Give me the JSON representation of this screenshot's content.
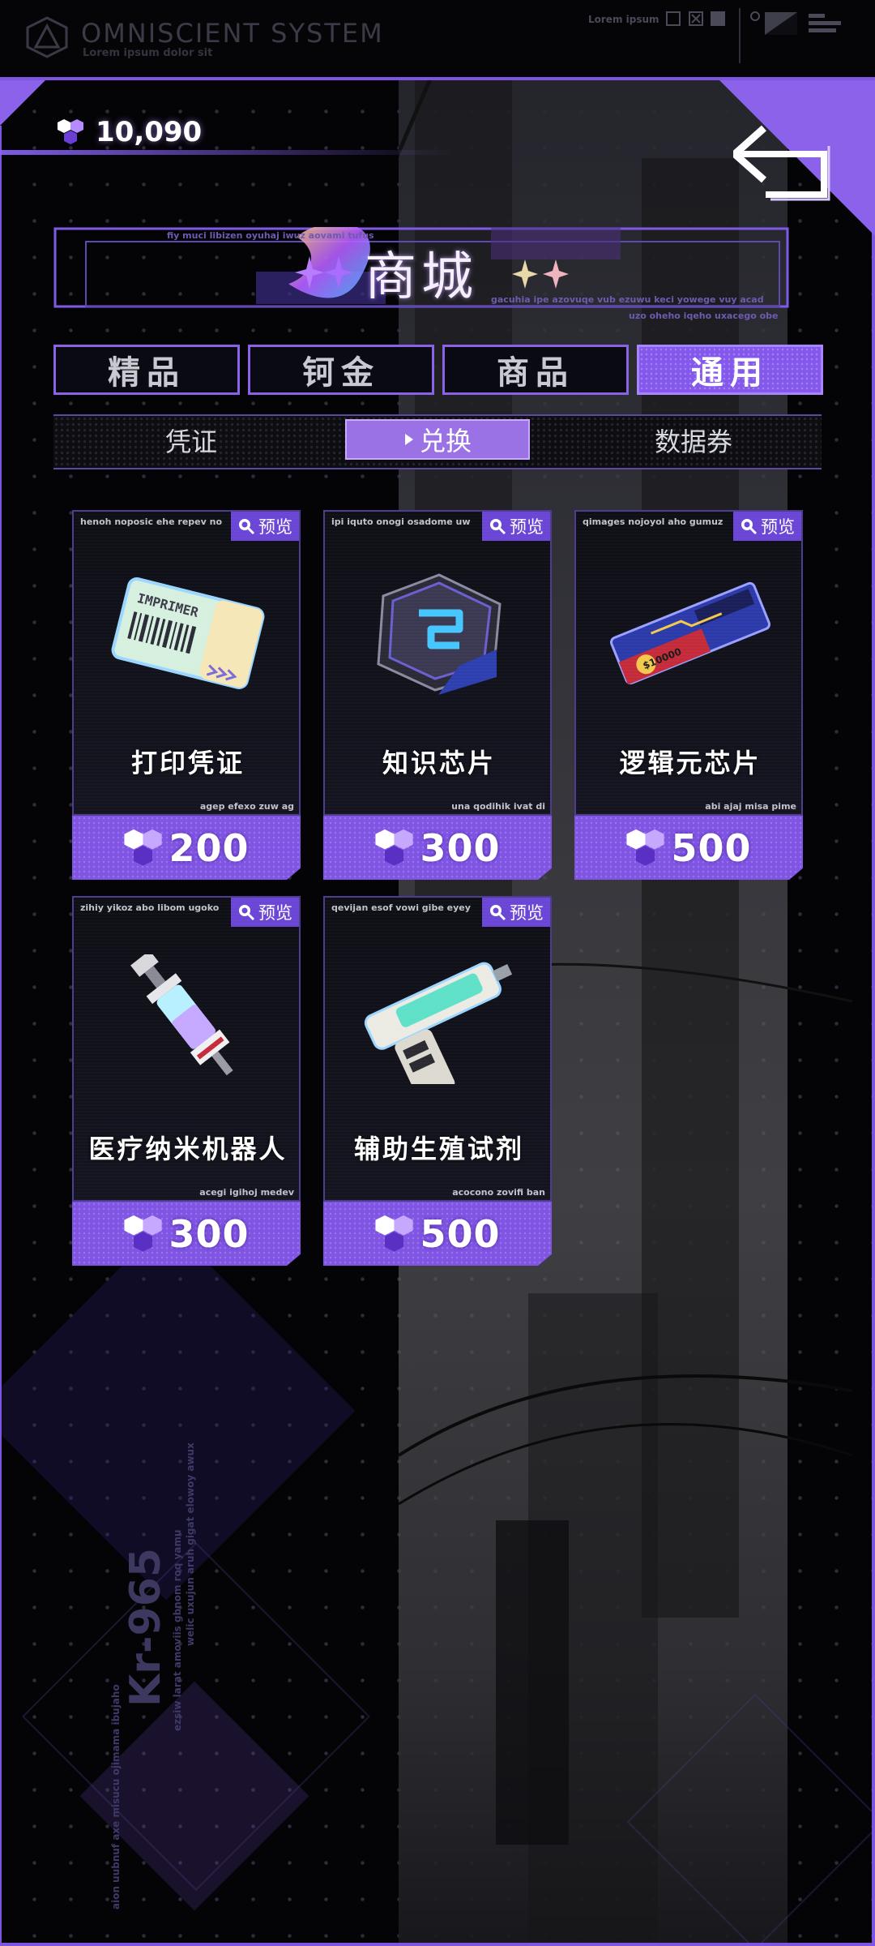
{
  "system": {
    "title": "OMNISCIENT  SYSTEM",
    "subtitle": "Lorem ipsum dolor sit",
    "status_label": "Lorem ipsum"
  },
  "currency": {
    "amount": "10,090",
    "icon": "hex-gem-icon"
  },
  "shop": {
    "title": "商城",
    "micro_top": "fiy muci libizen oyuhaj iwuz aovami tufus",
    "micro_right_1": "gacuhia ipe azovuqe vub ezuwu keci yowege vuy acad",
    "micro_right_2": "uzo oheho iqeho uxacego obe"
  },
  "tabs": [
    {
      "label": "精品",
      "active": false
    },
    {
      "label": "钶金",
      "active": false
    },
    {
      "label": "商品",
      "active": false
    },
    {
      "label": "通用",
      "active": true
    }
  ],
  "subtabs": [
    {
      "label": "凭证",
      "active": false
    },
    {
      "label": "兑换",
      "active": true
    },
    {
      "label": "数据券",
      "active": false
    }
  ],
  "preview_label": "预览",
  "items": [
    {
      "name": "打印凭证",
      "price": "200",
      "tag": "henoh noposic ehe repev no",
      "foot": "agep efexo zuw ag",
      "icon": "ticket-icon"
    },
    {
      "name": "知识芯片",
      "price": "300",
      "tag": "ipi iquto onogi osadome uw",
      "foot": "una qodihik ivat di",
      "icon": "chip-icon"
    },
    {
      "name": "逻辑元芯片",
      "price": "500",
      "tag": "qimages nojoyol aho gumuz",
      "foot": "abi ajaj misa pime",
      "icon": "logic-chip-icon"
    },
    {
      "name": "医疗纳米机器人",
      "price": "300",
      "tag": "zihiy yikoz abo libom ugoko",
      "foot": "acegi igihoj medev",
      "icon": "syringe-icon"
    },
    {
      "name": "辅助生殖试剂",
      "price": "500",
      "tag": "qevijan esof vowi gibe eyey",
      "foot": "acocono zovifi ban",
      "icon": "injector-gun-icon"
    }
  ],
  "decor": {
    "code": "Kr-965",
    "vline1": "ezsiw larat amoviis gbnom roq yamu",
    "vline2": "welic uxujun aruh gigat elowoy awux",
    "vline3": "aion uubnuf axe misucu ojimama ibujaho"
  },
  "colors": {
    "accent": "#8458ec",
    "accent_light": "#a884ff",
    "background": "#040406"
  }
}
